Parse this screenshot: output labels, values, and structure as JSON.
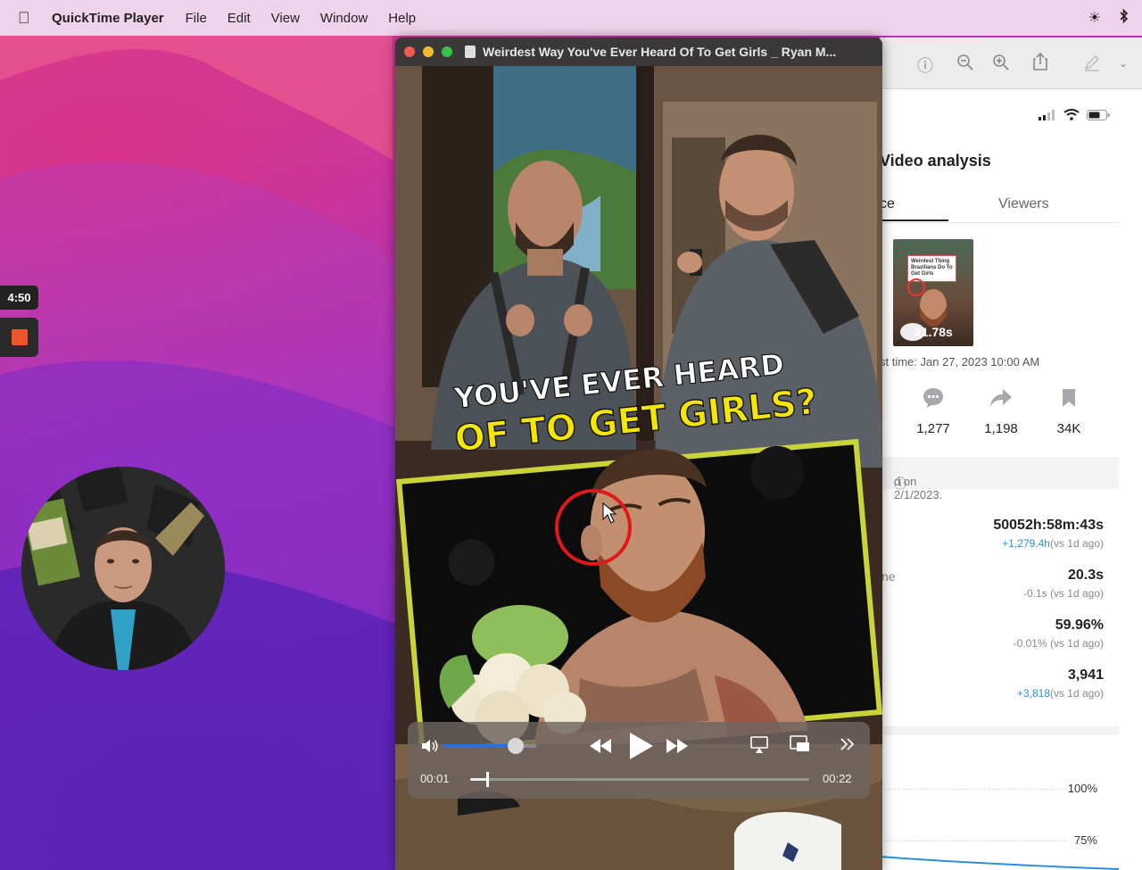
{
  "menubar": {
    "app_name": "QuickTime Player",
    "menus": [
      "File",
      "Edit",
      "View",
      "Window",
      "Help"
    ]
  },
  "recorder": {
    "timer": "4:50"
  },
  "quicktime": {
    "window_title": "Weirdest Way You've Ever Heard Of To Get Girls _ Ryan M...",
    "caption_line1": "YOU'VE EVER HEARD",
    "caption_line2": "OF TO GET GIRLS?",
    "current_time": "00:01",
    "duration": "00:22",
    "volume_level": 0.78,
    "playback_progress": 0.05
  },
  "analytics": {
    "title": "Video analysis",
    "tab_overview": "ce",
    "tab_viewers": "Viewers",
    "thumb_card_text": "Weirdest Thing Brazilians Do To Get Girls",
    "thumb_value": "21.78s",
    "post_time": "st time: Jan 27, 2023 10:00 AM",
    "stats": [
      {
        "icon": "comment-icon",
        "value": "1,277"
      },
      {
        "icon": "share-icon",
        "value": "1,198"
      },
      {
        "icon": "bookmark-icon",
        "value": "34K"
      }
    ],
    "updated": "d on 2/1/2023.",
    "metrics": [
      {
        "label": "",
        "value": "50052h:58m:43s",
        "delta_up": "+1,279.4h",
        "delta_suffix": "(vs 1d ago)"
      },
      {
        "label": "ne",
        "value": "20.3s",
        "delta_up": "",
        "delta_suffix": "-0.1s (vs 1d ago)"
      },
      {
        "label": "",
        "value": "59.96%",
        "delta_up": "",
        "delta_suffix": "-0.01% (vs 1d ago)"
      },
      {
        "label": "",
        "value": "3,941",
        "delta_up": "+3,818",
        "delta_suffix": "(vs 1d ago)"
      }
    ],
    "chart_ticks": [
      "100%",
      "75%"
    ]
  },
  "colors": {
    "menubar_bg": "#efd3ea",
    "traffic_red": "#ee5b53",
    "traffic_yellow": "#f3bd2e",
    "traffic_green": "#35c448",
    "caption_yellow": "#f5e600",
    "stop_red": "#f0552e",
    "delta_blue": "#2b8fd8"
  }
}
